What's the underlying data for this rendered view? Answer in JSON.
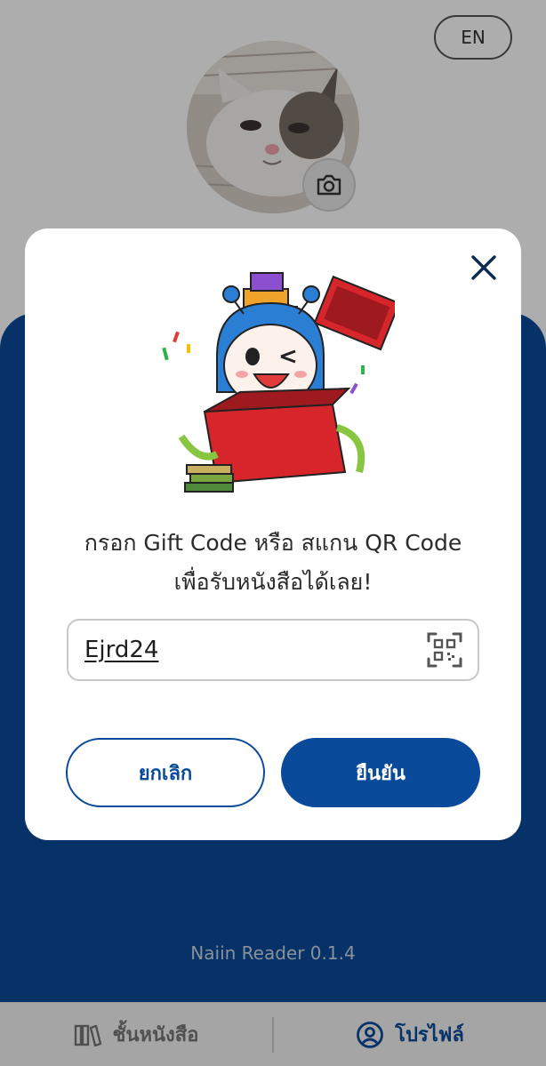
{
  "header": {
    "language_button": "EN"
  },
  "profile": {
    "avatar_icon": "cat-photo-avatar",
    "camera_icon": "camera-icon"
  },
  "footer": {
    "version": "Naiin Reader 0.1.4"
  },
  "bottom_nav": {
    "items": [
      {
        "label": "ชั้นหนังสือ",
        "icon": "bookshelf-icon",
        "active": false
      },
      {
        "label": "โปรไฟล์",
        "icon": "profile-icon",
        "active": true
      }
    ]
  },
  "modal": {
    "close_icon": "close-icon",
    "illustration": "mascot-gift-box-illustration",
    "prompt_line1": "กรอก Gift Code หรือ สแกน QR Code",
    "prompt_line2": "เพื่อรับหนังสือได้เลย!",
    "code_input": {
      "value": "Ejrd24",
      "scan_icon": "qr-scan-icon"
    },
    "cancel_label": "ยกเลิก",
    "confirm_label": "ยืนยัน"
  },
  "colors": {
    "primary": "#0a4a9a",
    "overlay": "rgba(0,0,0,0.32)"
  }
}
